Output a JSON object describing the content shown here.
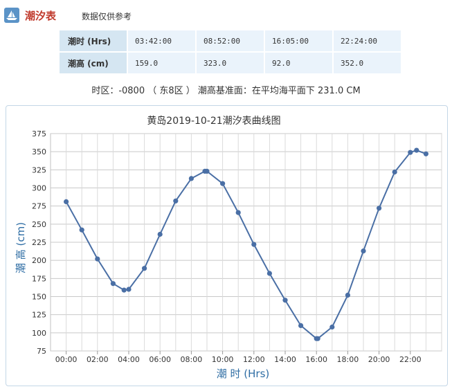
{
  "header": {
    "title": "潮汐表",
    "note": "数据仅供参考",
    "icon": "boat-icon"
  },
  "table": {
    "rows": [
      {
        "label": "潮时 (Hrs)",
        "values": [
          "03:42:00",
          "08:52:00",
          "16:05:00",
          "22:24:00"
        ]
      },
      {
        "label": "潮高 (cm)",
        "values": [
          "159.0",
          "323.0",
          "92.0",
          "352.0"
        ]
      }
    ]
  },
  "info": "时区：-0800 （ 东8区 ） 潮高基准面：在平均海平面下 231.0 CM",
  "colors": {
    "series": "#4a6fa5",
    "title_text": "#2e6da4",
    "header_title": "#c0392b"
  },
  "chart_data": {
    "type": "line",
    "title": "黄岛2019-10-21潮汐表曲线图",
    "xlabel": "潮 时 (Hrs)",
    "ylabel": "潮 高 (cm)",
    "ylim": [
      75,
      375
    ],
    "yticks": [
      75,
      100,
      125,
      150,
      175,
      200,
      225,
      250,
      275,
      300,
      325,
      350,
      375
    ],
    "xlim": [
      -1.0,
      24.0
    ],
    "xticks": [
      "00:00",
      "02:00",
      "04:00",
      "06:00",
      "08:00",
      "10:00",
      "12:00",
      "14:00",
      "16:00",
      "18:00",
      "20:00",
      "22:00"
    ],
    "grid": true,
    "series": [
      {
        "x": [
          "00:00",
          "01:00",
          "02:00",
          "03:00",
          "03:42",
          "04:00",
          "05:00",
          "06:00",
          "07:00",
          "08:00",
          "08:52",
          "09:00",
          "10:00",
          "11:00",
          "12:00",
          "13:00",
          "14:00",
          "15:00",
          "16:00",
          "16:05",
          "17:00",
          "18:00",
          "19:00",
          "20:00",
          "21:00",
          "22:00",
          "22:24",
          "23:00"
        ],
        "values": [
          281,
          242,
          202,
          168,
          159,
          160,
          189,
          236,
          282,
          313,
          323,
          323,
          306,
          266,
          222,
          182,
          145,
          110,
          92,
          92,
          108,
          152,
          213,
          272,
          322,
          349,
          352,
          347
        ]
      }
    ]
  }
}
